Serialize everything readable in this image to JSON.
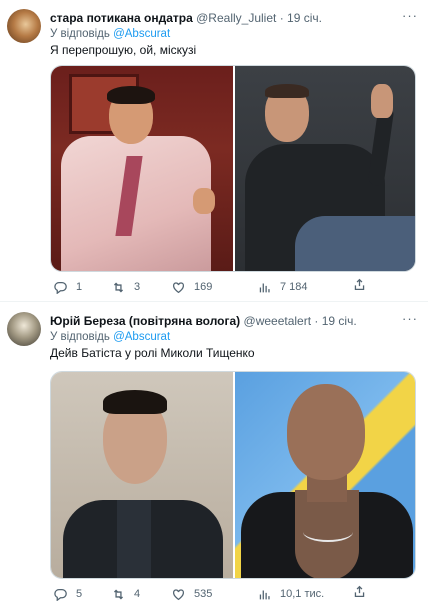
{
  "tweets": [
    {
      "display_name": "стара потикана ондатра",
      "handle": "@Really_Juliet",
      "separator": "·",
      "time": "19 січ.",
      "reply_prefix": "У відповідь",
      "reply_to": "@Abscurat",
      "text": "Я перепрошую, ой, міскузі",
      "media": [
        {
          "icon": "photo-actor-pink-suit"
        },
        {
          "icon": "photo-man-dark-sweater"
        }
      ],
      "stats": {
        "replies": "1",
        "retweets": "3",
        "likes": "169",
        "views": "7 184"
      }
    },
    {
      "display_name": "Юрій Береза (повітряна волога)",
      "handle": "@weeetalert",
      "separator": "·",
      "time": "19 січ.",
      "reply_prefix": "У відповідь",
      "reply_to": "@Abscurat",
      "text": "Дейв Батіста у ролі Миколи Тищенко",
      "media": [
        {
          "icon": "photo-politician"
        },
        {
          "icon": "photo-bald-man-tattoo"
        }
      ],
      "stats": {
        "replies": "5",
        "retweets": "4",
        "likes": "535",
        "views": "10,1 тис."
      }
    }
  ],
  "colors": {
    "link": "#1d9bf0",
    "secondary_text": "#536471",
    "primary_text": "#0f1419",
    "border": "#cfd9de"
  }
}
